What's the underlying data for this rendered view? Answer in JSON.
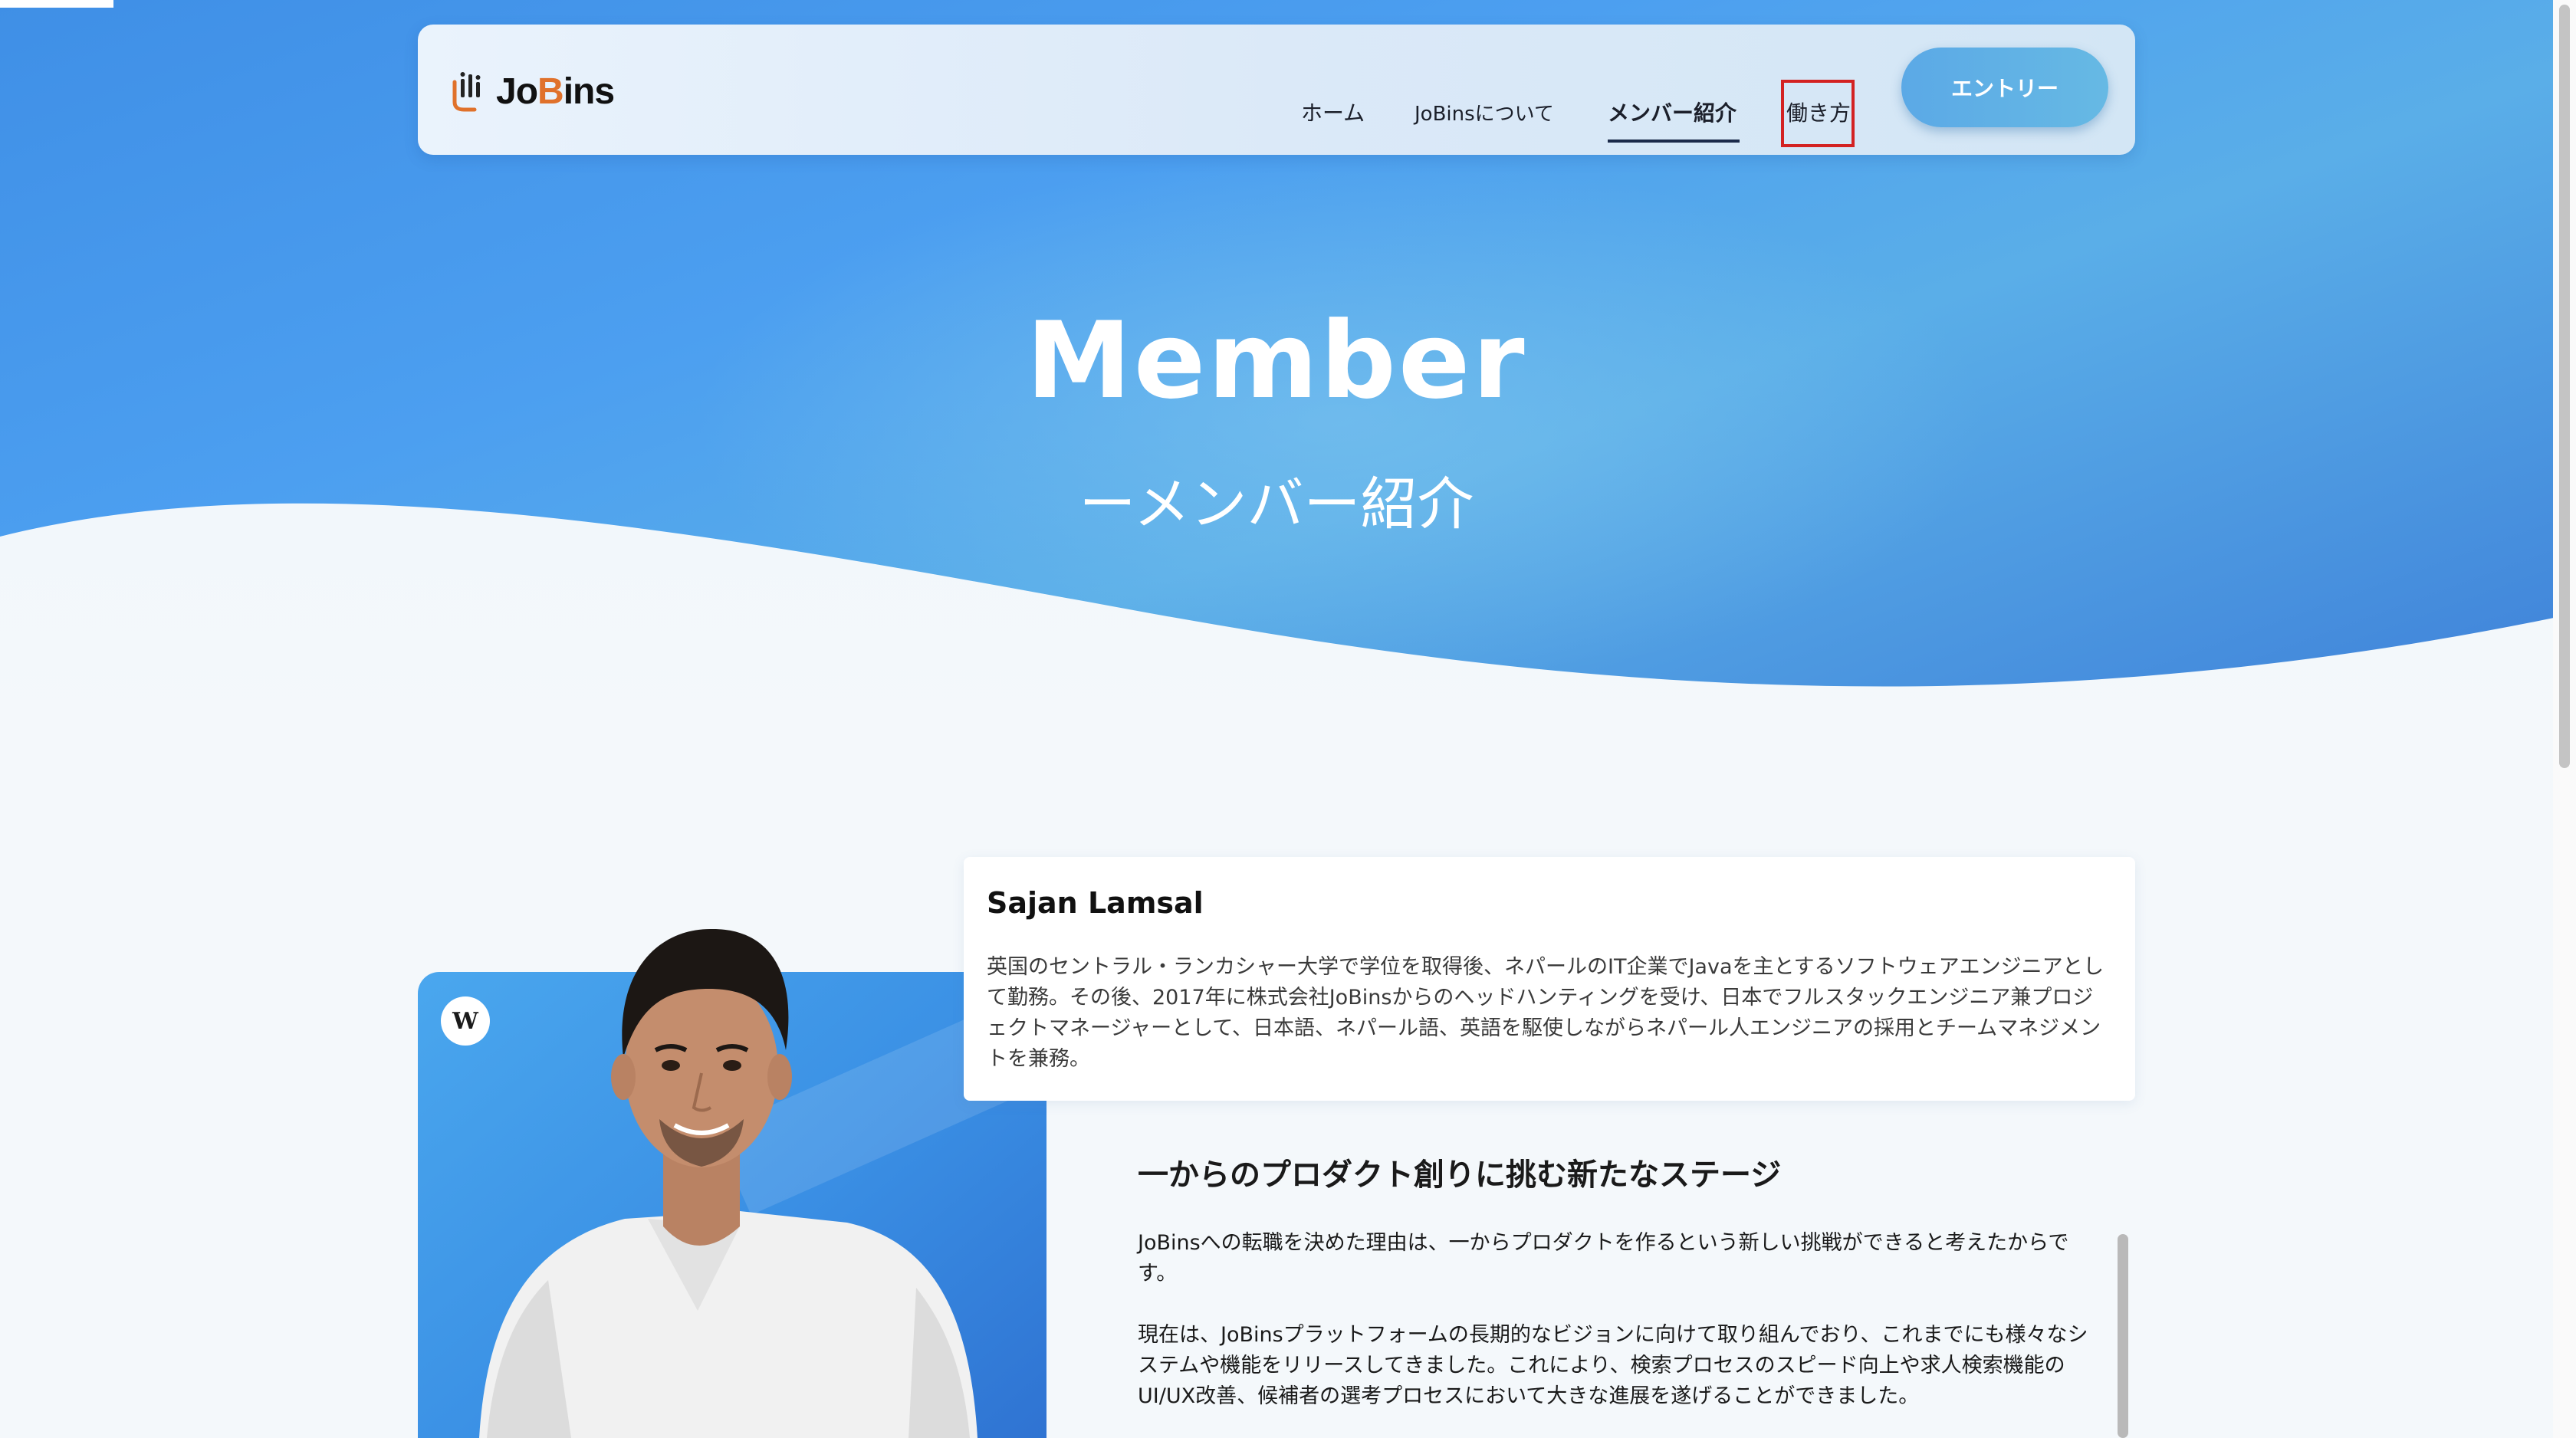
{
  "header": {
    "logo_text_prefix": "Jo",
    "logo_text_b": "B",
    "logo_text_suffix": "ins",
    "nav": {
      "home": "ホーム",
      "about": "JoBinsについて",
      "members": "メンバー紹介",
      "work_style": "働き方"
    },
    "entry_button": "エントリー"
  },
  "hero": {
    "title": "Member",
    "subtitle": "ーメンバー紹介"
  },
  "member": {
    "name": "Sajan Lamsal",
    "badge": "W",
    "bio": "英国のセントラル・ランカシャー大学で学位を取得後、ネパールのIT企業でJavaを主とするソフトウェアエンジニアとして勤務。その後、2017年に株式会社JoBinsからのヘッドハンティングを受け、日本でフルスタックエンジニア兼プロジェクトマネージャーとして、日本語、ネパール語、英語を駆使しながらネパール人エンジニアの採用とチームマネジメントを兼務。"
  },
  "story": {
    "title": "一からのプロダクト創りに挑む新たなステージ",
    "paragraph_1": "JoBinsへの転職を決めた理由は、一からプロダクトを作るという新しい挑戦ができると考えたからです。",
    "paragraph_2": "現在は、JoBinsプラットフォームの長期的なビジョンに向けて取り組んでおり、これまでにも様々なシステムや機能をリリースしてきました。これにより、検索プロセスのスピード向上や求人検索機能のUI/UX改善、候補者の選考プロセスにおいて大きな進展を遂げることができました。"
  },
  "colors": {
    "hero_blue": "#4c9ff0",
    "entry_button": "#5ba9e6",
    "logo_accent": "#e0712b",
    "highlight_box": "#d32222"
  }
}
